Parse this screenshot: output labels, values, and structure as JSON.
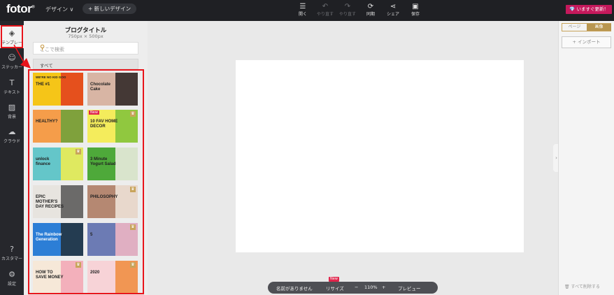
{
  "topbar": {
    "logo": "fotor",
    "logo_mark": "®",
    "design_menu": "デザイン ∨",
    "new_design": "+ 新しいデザイン",
    "tools": [
      {
        "label": "開く",
        "icon": "menu-icon"
      },
      {
        "label": "やり直す",
        "icon": "undo-icon"
      },
      {
        "label": "やり直す",
        "icon": "redo-icon"
      },
      {
        "label": "同期",
        "icon": "sync-icon"
      },
      {
        "label": "シェア",
        "icon": "share-icon"
      },
      {
        "label": "保存",
        "icon": "save-icon"
      }
    ],
    "upgrade": "💎 いますぐ更新！"
  },
  "rail": {
    "items": [
      {
        "label": "テンプレー",
        "icon": "layers-icon"
      },
      {
        "label": "ステッカー",
        "icon": "sticker-icon"
      },
      {
        "label": "テキスト",
        "icon": "text-icon"
      },
      {
        "label": "背景",
        "icon": "background-icon"
      },
      {
        "label": "クラウド",
        "icon": "cloud-icon"
      }
    ],
    "bottom": [
      {
        "label": "カスタマー",
        "icon": "help-icon"
      },
      {
        "label": "設定",
        "icon": "settings-icon"
      }
    ]
  },
  "panel": {
    "title": "ブログタイトル",
    "size": "750px × 500px",
    "search_placeholder": "ここで検索",
    "filter": "すべて",
    "templates": [
      {
        "text": "THE #1",
        "sub": "WE'RE NO KID GOO",
        "bg": "#f5c518",
        "accent": "#e23b1f",
        "crown": false,
        "isnew": false
      },
      {
        "text": "Chocolate Cake",
        "sub": "",
        "bg": "#d8b5a4",
        "accent": "#2a2222",
        "crown": false,
        "isnew": false
      },
      {
        "text": "HEALTHY?",
        "sub": "",
        "bg": "#f59d4a",
        "accent": "#6aa23a",
        "crown": false,
        "isnew": false
      },
      {
        "text": "10 FAV HOME DECOR",
        "sub": "",
        "bg": "#f4ec5c",
        "accent": "#7ec23a",
        "crown": true,
        "isnew": true
      },
      {
        "text": "unlock finance",
        "sub": "",
        "bg": "#64c6c9",
        "accent": "#f5ef4e",
        "crown": true,
        "isnew": false
      },
      {
        "text": "3 Minute Yogurt Salad",
        "sub": "",
        "bg": "#4ea93a",
        "accent": "#f2efe6",
        "crown": false,
        "isnew": false
      },
      {
        "text": "EPIC MOTHER'S DAY RECIPES",
        "sub": "",
        "bg": "#e7e4df",
        "accent": "#555",
        "crown": false,
        "isnew": false
      },
      {
        "text": "PHILOSOPHY",
        "sub": "",
        "bg": "#b58872",
        "accent": "#f1e6dc",
        "crown": true,
        "isnew": false
      },
      {
        "text": "The Rainbow Generation",
        "sub": "",
        "bg": "#2c7ed6",
        "accent": "#23303a",
        "crown": false,
        "isnew": false
      },
      {
        "text": "5",
        "sub": "",
        "bg": "#6c7bb4",
        "accent": "#f4b8c4",
        "crown": true,
        "isnew": false
      },
      {
        "text": "HOW TO SAVE MONEY",
        "sub": "",
        "bg": "#f6e8d8",
        "accent": "#f2a6b6",
        "crown": true,
        "isnew": false
      },
      {
        "text": "2020",
        "sub": "",
        "bg": "#f7d3d7",
        "accent": "#f08b3c",
        "crown": true,
        "isnew": false
      }
    ]
  },
  "right": {
    "tab_page": "ページ",
    "tab_image": "画像",
    "import": "+ インポート",
    "delete_all": "すべて削除する"
  },
  "bottom": {
    "name": "名前がありません",
    "resize": "リサイズ",
    "new": "New",
    "minus": "−",
    "zoom": "110%",
    "plus": "+",
    "preview": "プレビュー"
  },
  "colors": {
    "accent": "#c8a45b",
    "highlight": "#e8141b",
    "brand_pink": "#c5195c"
  }
}
